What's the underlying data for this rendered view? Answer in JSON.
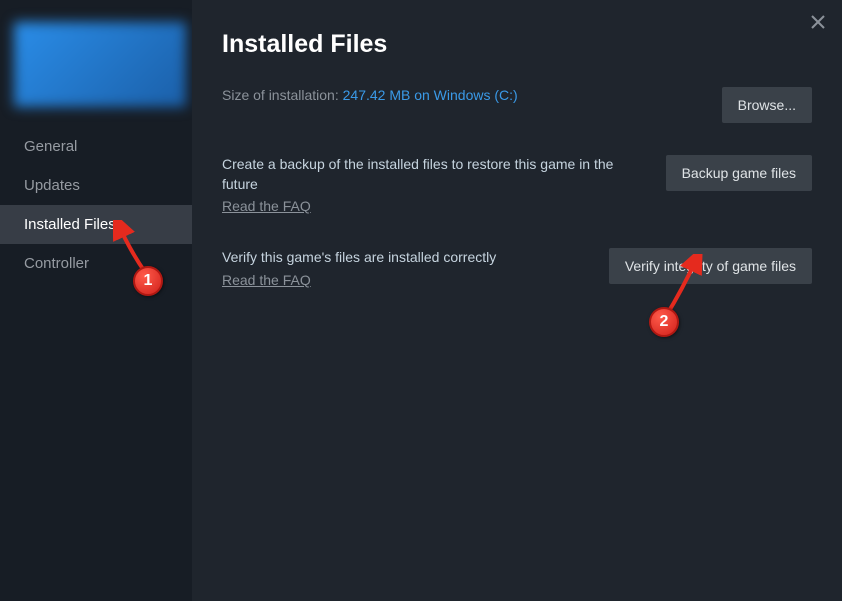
{
  "page_title": "Installed Files",
  "sidebar": {
    "items": [
      {
        "label": "General",
        "active": false
      },
      {
        "label": "Updates",
        "active": false
      },
      {
        "label": "Installed Files",
        "active": true
      },
      {
        "label": "Controller",
        "active": false
      }
    ]
  },
  "size_row": {
    "label": "Size of installation: ",
    "value": "247.42 MB on Windows (C:)",
    "button": "Browse..."
  },
  "backup_row": {
    "desc": "Create a backup of the installed files to restore this game in the future",
    "faq": "Read the FAQ",
    "button": "Backup game files"
  },
  "verify_row": {
    "desc": "Verify this game's files are installed correctly",
    "faq": "Read the FAQ",
    "button": "Verify integrity of game files"
  },
  "annotations": {
    "badge1": "1",
    "badge2": "2"
  }
}
